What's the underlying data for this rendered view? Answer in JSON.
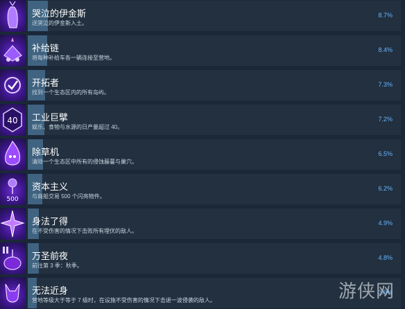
{
  "achievements": [
    {
      "title": "哭泣的伊金斯",
      "description": "送哭泣的伊金斯入土。",
      "percent": "8.7%",
      "progress": 0.087,
      "icon": "deer-spirit-icon"
    },
    {
      "title": "补给链",
      "description": "将每种补给车各一辆连接至营地。",
      "percent": "8.4%",
      "progress": 0.084,
      "icon": "supply-cart-icon"
    },
    {
      "title": "开拓者",
      "description": "找到一个生态区内的所有岛屿。",
      "percent": "7.3%",
      "progress": 0.073,
      "icon": "checkmark-badge-icon"
    },
    {
      "title": "工业巨擘",
      "description": "娱乐、食物与水源的日产量超过 40。",
      "percent": "7.2%",
      "progress": 0.072,
      "icon": "number-40-icon",
      "icon_text": "40"
    },
    {
      "title": "除草机",
      "description": "清除一个生态区中所有的侵蚀藤蔓与巢穴。",
      "percent": "6.5%",
      "progress": 0.065,
      "icon": "flame-creature-icon"
    },
    {
      "title": "资本主义",
      "description": "与商船交易 500 个闪亮物件。",
      "percent": "6.2%",
      "progress": 0.062,
      "icon": "coin-500-icon",
      "icon_text": "500"
    },
    {
      "title": "身法了得",
      "description": "在不受伤害的情况下击败所有埋伏的敌人。",
      "percent": "4.9%",
      "progress": 0.049,
      "icon": "burst-icon"
    },
    {
      "title": "万圣前夜",
      "description": "前往第 3 季：秋季。",
      "percent": "4.8%",
      "progress": 0.048,
      "icon": "pumpkin-night-icon"
    },
    {
      "title": "无法近身",
      "description": "营地等级大于等于 7 级时，在设施不受伤害的情况下击退一波侵袭的敌人。",
      "percent": "3.9%",
      "progress": 0.039,
      "icon": "horned-beast-icon"
    }
  ],
  "watermark": "游侠网",
  "colors": {
    "background": "#1b2838",
    "card": "#22303f",
    "progress": "#3f6380",
    "percent": "#67b5ff",
    "icon_purple": "#6a2bd0"
  }
}
